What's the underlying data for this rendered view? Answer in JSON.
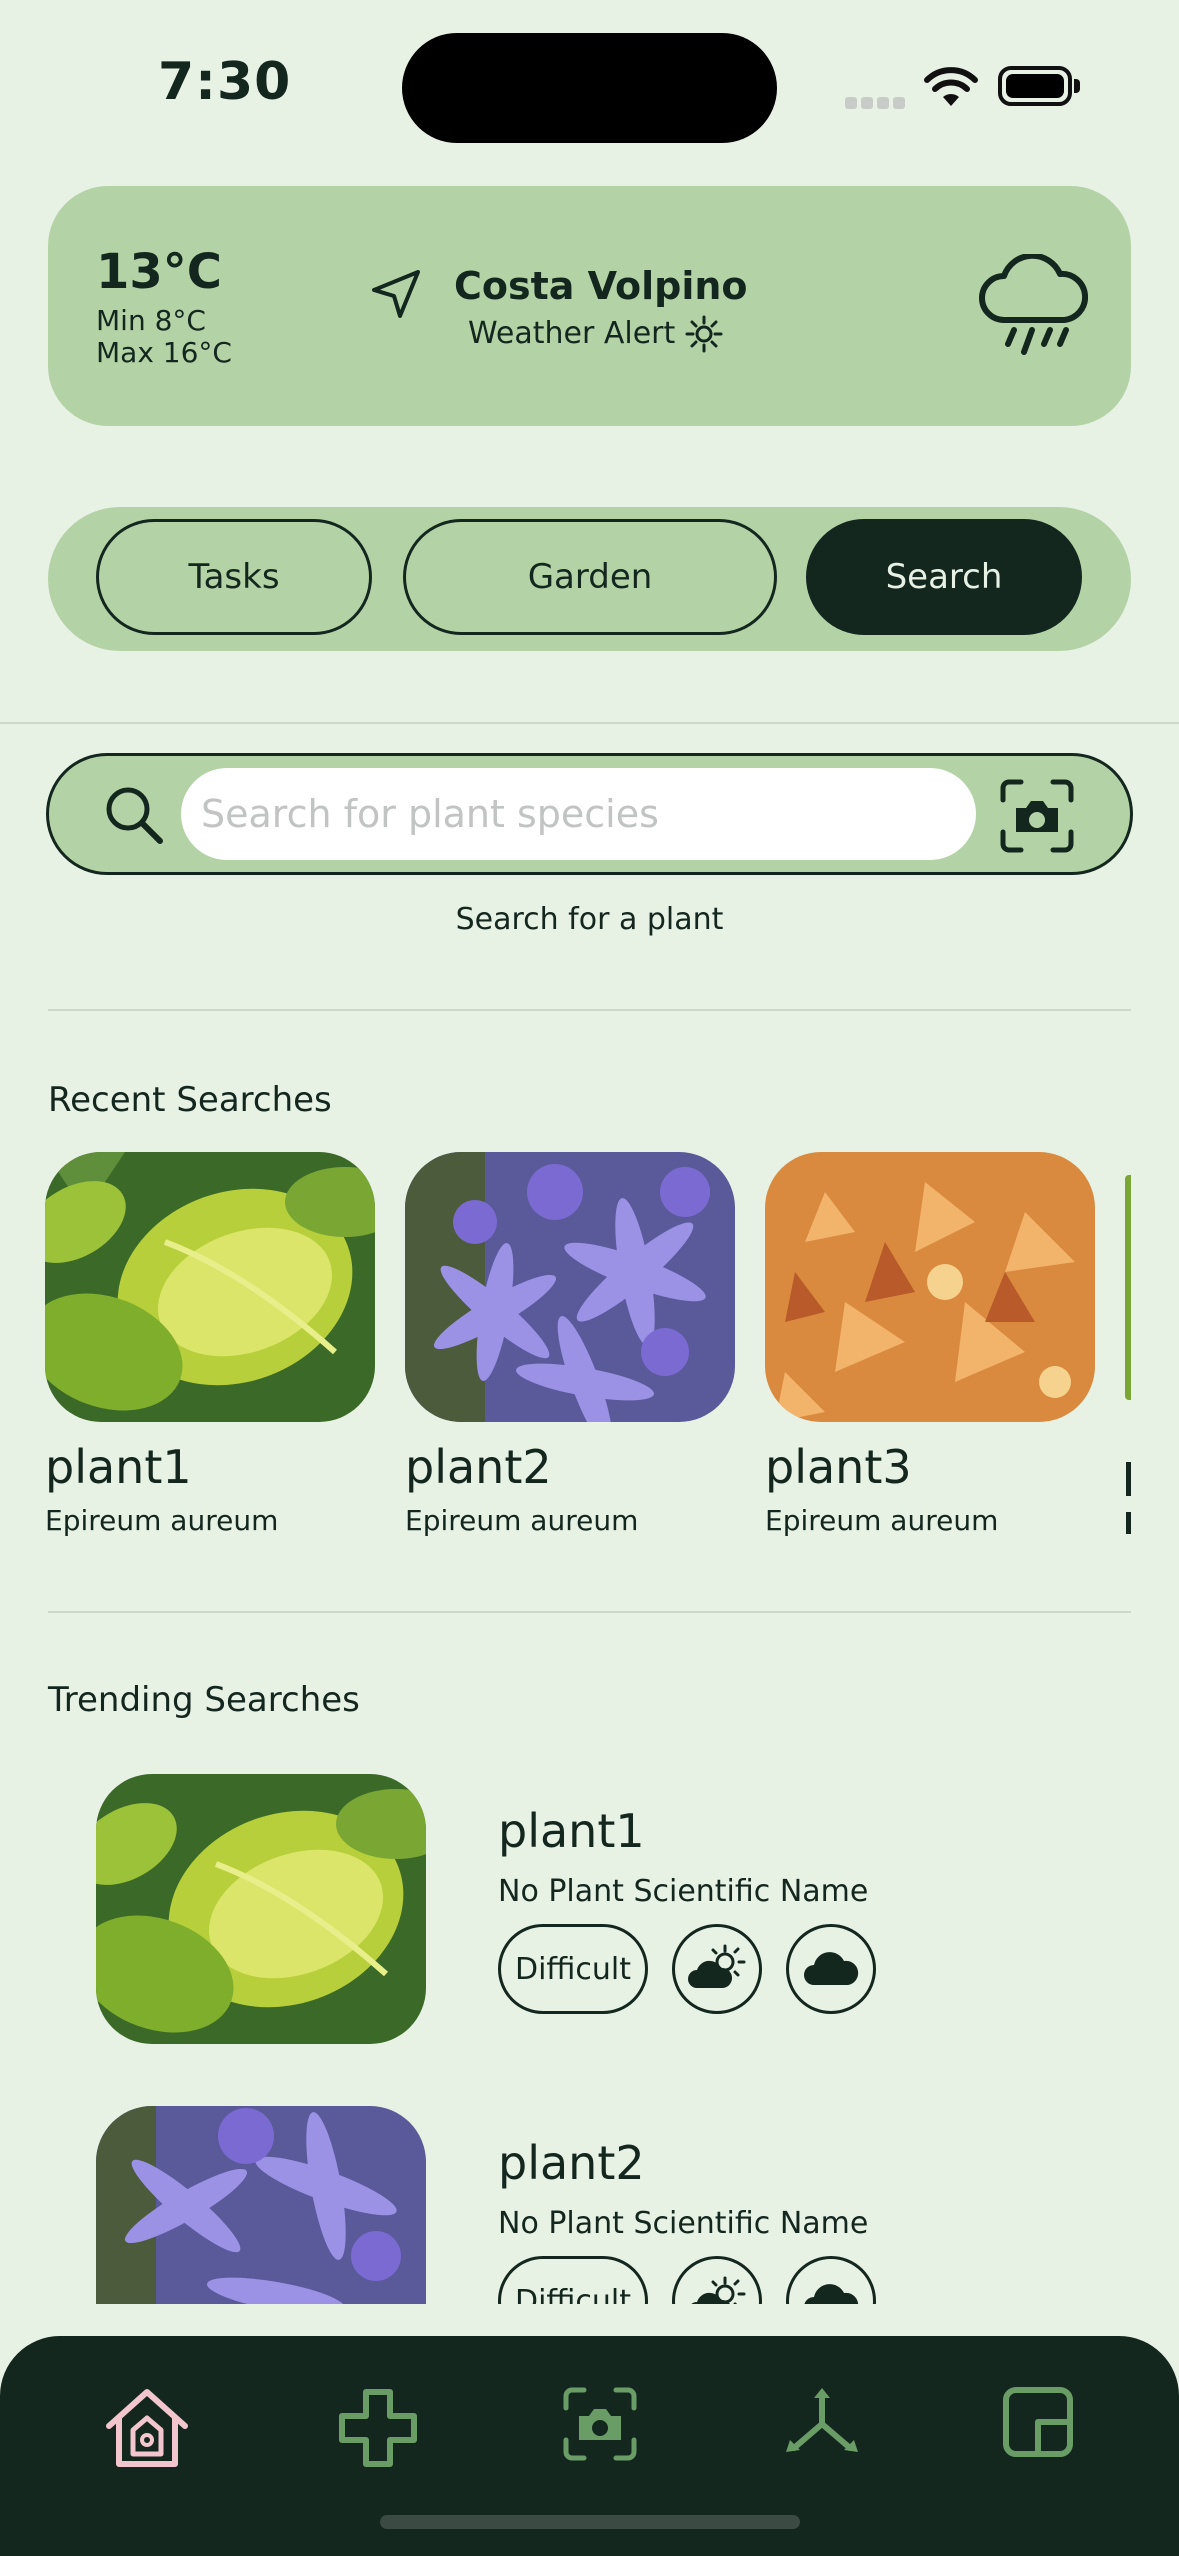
{
  "status_bar": {
    "time": "7:30"
  },
  "weather": {
    "temperature": "13°C",
    "min": "Min 8°C",
    "max": "Max 16°C",
    "location": "Costa Volpino",
    "alert": "Weather Alert",
    "location_icon": "navigation-arrow-icon",
    "alert_icon": "sun-alert-icon",
    "condition_icon": "rain-cloud-icon"
  },
  "tabs": [
    {
      "label": "Tasks",
      "active": false
    },
    {
      "label": "Garden",
      "active": false
    },
    {
      "label": "Search",
      "active": true
    }
  ],
  "search": {
    "placeholder": "Search for plant species",
    "caption": "Search for a plant"
  },
  "recent": {
    "title": "Recent Searches",
    "items": [
      {
        "name": "plant1",
        "scientific": "Epireum aureum",
        "image": "pothos-leaves"
      },
      {
        "name": "plant2",
        "scientific": "Epireum aureum",
        "image": "purple-flowers"
      },
      {
        "name": "plant3",
        "scientific": "Epireum aureum",
        "image": "orange-maple-leaves"
      }
    ]
  },
  "trending": {
    "title": "Trending Searches",
    "items": [
      {
        "name": "plant1",
        "scientific": "No Plant Scientific Name",
        "difficulty": "Difficult",
        "image": "pothos-leaves"
      },
      {
        "name": "plant2",
        "scientific": "No Plant Scientific Name",
        "difficulty": "Difficult",
        "image": "purple-flowers"
      }
    ]
  },
  "bottom_nav": [
    "home-icon",
    "plus-icon",
    "camera-icon",
    "share-nodes-icon",
    "widget-icon"
  ],
  "colors": {
    "background": "#e7f1e4",
    "accent": "#b3d3a6",
    "dark": "#13271f",
    "nav_active": "#f2c6cc",
    "nav_inactive": "#6a9d66"
  }
}
